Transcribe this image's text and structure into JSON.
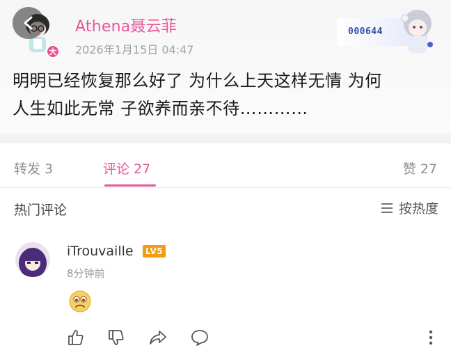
{
  "post": {
    "author_name": "Athena聂云菲",
    "vip_badge": "大",
    "time": "2026年1月15日 04:47",
    "fan_card_number": "000644",
    "text_line1": "明明已经恢复那么好了 为什么上天这样无情 为何",
    "text_line2": "人生如此无常 子欲养而亲不待…………"
  },
  "tabs": {
    "repost": "转发 3",
    "comments": "评论 27",
    "likes": "赞 27"
  },
  "section": {
    "hot_title": "热门评论",
    "sort_label": "按热度"
  },
  "comment": {
    "username": "iTrouvaille",
    "level": "LV5",
    "time": "8分钟前"
  },
  "colors": {
    "accent": "#e9549a",
    "level_badge": "#f39c12"
  },
  "icons": [
    "back-icon",
    "vip-badge",
    "sort-icon",
    "thumbs-up-icon",
    "thumbs-down-icon",
    "share-icon",
    "reply-icon",
    "more-icon",
    "sad-face-emoji"
  ]
}
